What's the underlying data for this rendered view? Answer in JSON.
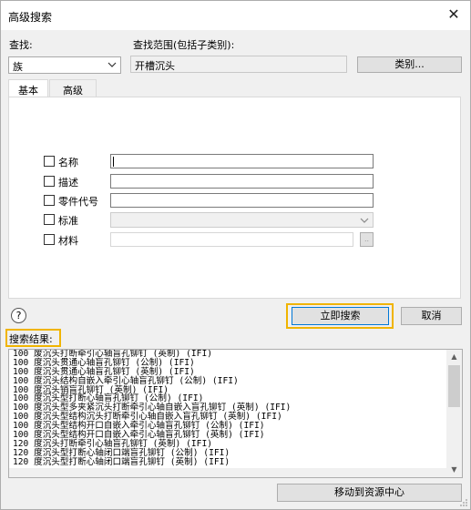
{
  "window": {
    "title": "高级搜索"
  },
  "search": {
    "find_label": "查找:",
    "find_value": "族",
    "scope_label": "查找范围(包括子类别):",
    "scope_value": "开槽沉头",
    "category_button": "类别..."
  },
  "tabs": [
    {
      "label": "基本"
    },
    {
      "label": "高级"
    }
  ],
  "fields": [
    {
      "label": "名称",
      "value": ""
    },
    {
      "label": "描述",
      "value": ""
    },
    {
      "label": "零件代号",
      "value": ""
    },
    {
      "label": "标准",
      "value": ""
    },
    {
      "label": "材料",
      "value": ""
    }
  ],
  "material_browse": "..",
  "buttons": {
    "search_now": "立即搜索",
    "cancel": "取消",
    "help": "?",
    "move_to_center": "移动到资源中心"
  },
  "results": {
    "label": "搜索结果:",
    "rows": [
      "100 废沉头打断牵引心轴盲孔铆钉 (英制) (IFI)",
      "100 度沉头贯通心轴盲孔铆钉 (公制) (IFI)",
      "100 度沉头贯通心轴盲孔铆钉 (英制) (IFI)",
      "100 度沉头结构自嵌入牵引心轴盲孔铆钉 (公制) (IFI)",
      "100 度沉头销盲孔铆钉 (英制) (IFI)",
      "100 度沉头型打断心轴盲孔铆钉 (公制) (IFI)",
      "100 度沉头型多夹紧沉头打断牵引心轴自嵌入盲孔铆钉 (英制) (IFI)",
      "100 度沉头型结构沉头打断牵引心轴自嵌入盲孔铆钉 (英制) (IFI)",
      "100 度沉头型结构开口自嵌入牵引心轴盲孔铆钉 (公制) (IFI)",
      "100 度沉头型结构开口自嵌入牵引心轴盲孔铆钉 (英制) (IFI)",
      "120 度沉头打断牵引心轴盲孔铆钉 (英制) (IFI)",
      "120 度沉头型打断心轴闭口端盲孔铆钉 (公制) (IFI)",
      "120 度沉头型打断心轴闭口端盲孔铆钉 (英制) (IFI)"
    ]
  },
  "colors": {
    "highlight": "#f0b400",
    "window_bg": "#f0f0f0"
  }
}
